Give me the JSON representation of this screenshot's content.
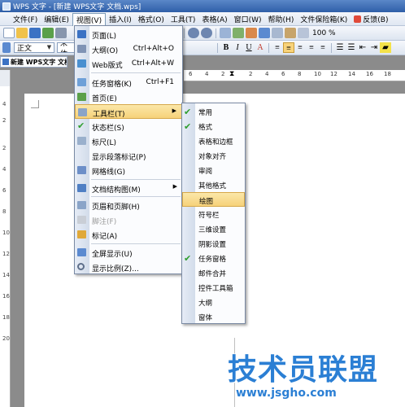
{
  "window": {
    "title": "WPS 文字 - [新建 WPS文字 文档.wps]"
  },
  "menubar": {
    "items": [
      {
        "label": "文件(F)"
      },
      {
        "label": "编辑(E)"
      },
      {
        "label": "视图(V)"
      },
      {
        "label": "插入(I)"
      },
      {
        "label": "格式(O)"
      },
      {
        "label": "工具(T)"
      },
      {
        "label": "表格(A)"
      },
      {
        "label": "窗口(W)"
      },
      {
        "label": "帮助(H)"
      },
      {
        "label": "文件保险箱(K)"
      },
      {
        "label": "反馈(B)"
      }
    ]
  },
  "formatting": {
    "style": "正文",
    "font": "宋体",
    "zoom": "100 %"
  },
  "document_tab": {
    "label": "新建 WPS文字 文档"
  },
  "ruler": {
    "h_numbers": [
      "6",
      "4",
      "2",
      "2",
      "4",
      "6",
      "8",
      "10",
      "12",
      "14",
      "16",
      "18"
    ],
    "v_numbers": [
      "4",
      "2",
      "2",
      "4",
      "6",
      "8",
      "10",
      "12",
      "14",
      "16",
      "18",
      "20"
    ]
  },
  "view_menu": {
    "items": [
      {
        "label": "页面(L)",
        "shortcut": ""
      },
      {
        "label": "大纲(O)",
        "shortcut": "Ctrl+Alt+O"
      },
      {
        "label": "Web版式",
        "shortcut": "Ctrl+Alt+W"
      },
      {
        "label": "任务窗格(K)",
        "shortcut": "Ctrl+F1"
      },
      {
        "label": "首页(E)",
        "shortcut": ""
      },
      {
        "label": "工具栏(T)",
        "shortcut": ""
      },
      {
        "label": "状态栏(S)",
        "shortcut": ""
      },
      {
        "label": "标尺(L)",
        "shortcut": ""
      },
      {
        "label": "显示段落标记(P)",
        "shortcut": ""
      },
      {
        "label": "网格线(G)",
        "shortcut": ""
      },
      {
        "label": "文档结构图(M)",
        "shortcut": ""
      },
      {
        "label": "页眉和页脚(H)",
        "shortcut": ""
      },
      {
        "label": "脚注(F)",
        "shortcut": ""
      },
      {
        "label": "标记(A)",
        "shortcut": ""
      },
      {
        "label": "全屏显示(U)",
        "shortcut": ""
      },
      {
        "label": "显示比例(Z)...",
        "shortcut": ""
      }
    ],
    "highlighted": "工具栏(T)",
    "colors": {
      "highlight": "#f6d27a",
      "icon_blue": "#3b72c4",
      "check_green": "#2f9e2f"
    }
  },
  "toolbars_submenu": {
    "items": [
      {
        "label": "常用",
        "checked": true
      },
      {
        "label": "格式",
        "checked": true
      },
      {
        "label": "表格和边框",
        "checked": false
      },
      {
        "label": "对象对齐",
        "checked": false
      },
      {
        "label": "审阅",
        "checked": false
      },
      {
        "label": "其他格式",
        "checked": false
      },
      {
        "label": "绘图",
        "checked": false
      },
      {
        "label": "符号栏",
        "checked": false
      },
      {
        "label": "三维设置",
        "checked": false
      },
      {
        "label": "阴影设置",
        "checked": false
      },
      {
        "label": "任务窗格",
        "checked": true
      },
      {
        "label": "邮件合并",
        "checked": false
      },
      {
        "label": "控件工具箱",
        "checked": false
      },
      {
        "label": "大纲",
        "checked": false
      },
      {
        "label": "窗体",
        "checked": false
      }
    ],
    "highlighted": "绘图"
  },
  "watermark": {
    "title": "技术员联盟",
    "url": "www.jsgho.com"
  }
}
